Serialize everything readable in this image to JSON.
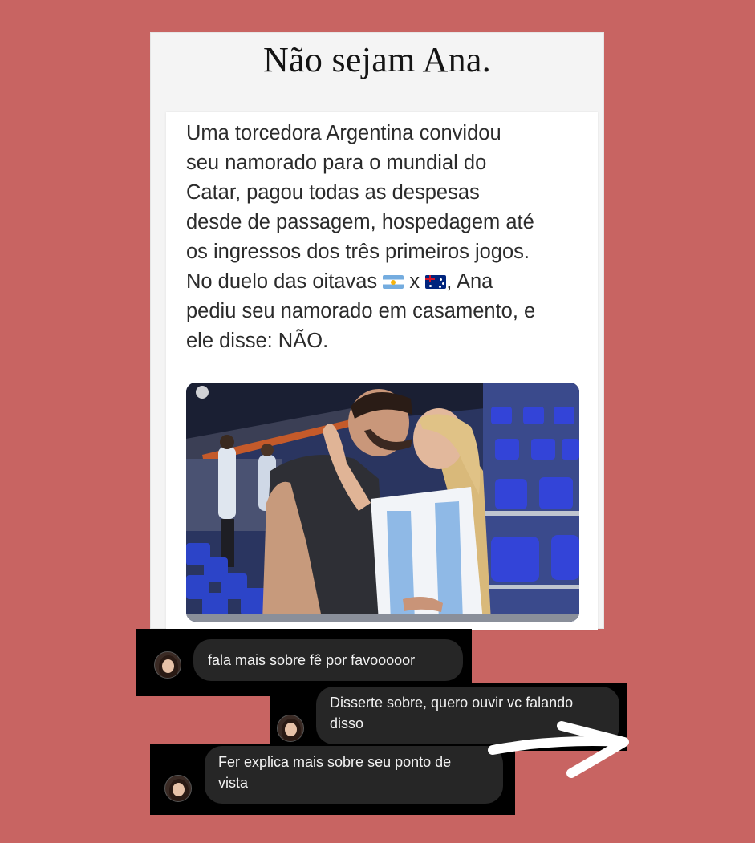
{
  "post": {
    "title": "Não sejam Ana.",
    "tweet_lines": [
      "Uma torcedora Argentina convidou",
      "seu namorado para o mundial do",
      "Catar, pagou todas as despesas",
      "desde de passagem, hospedagem até",
      "os ingressos dos três primeiros jogos."
    ],
    "tweet_duel_prefix": "No duelo das oitavas",
    "tweet_duel_x": "x",
    "tweet_duel_suffix": ", Ana",
    "tweet_last_lines": [
      "pediu seu namorado em casamento, e",
      "ele disse: NÃO."
    ],
    "flag_left": "argentina-flag-icon",
    "flag_right": "australia-flag-icon",
    "photo": "couple-kissing-in-stadium-photo"
  },
  "comments": [
    {
      "text": "fala mais sobre fê por favooooor"
    },
    {
      "text_lines": [
        "Disserte sobre, quero ouvir vc falando",
        "disso"
      ]
    },
    {
      "text_lines": [
        "Fer explica mais sobre seu ponto de",
        "vista"
      ]
    }
  ],
  "colors": {
    "background": "#c86462",
    "bubble": "#262626",
    "strip": "#000000"
  }
}
